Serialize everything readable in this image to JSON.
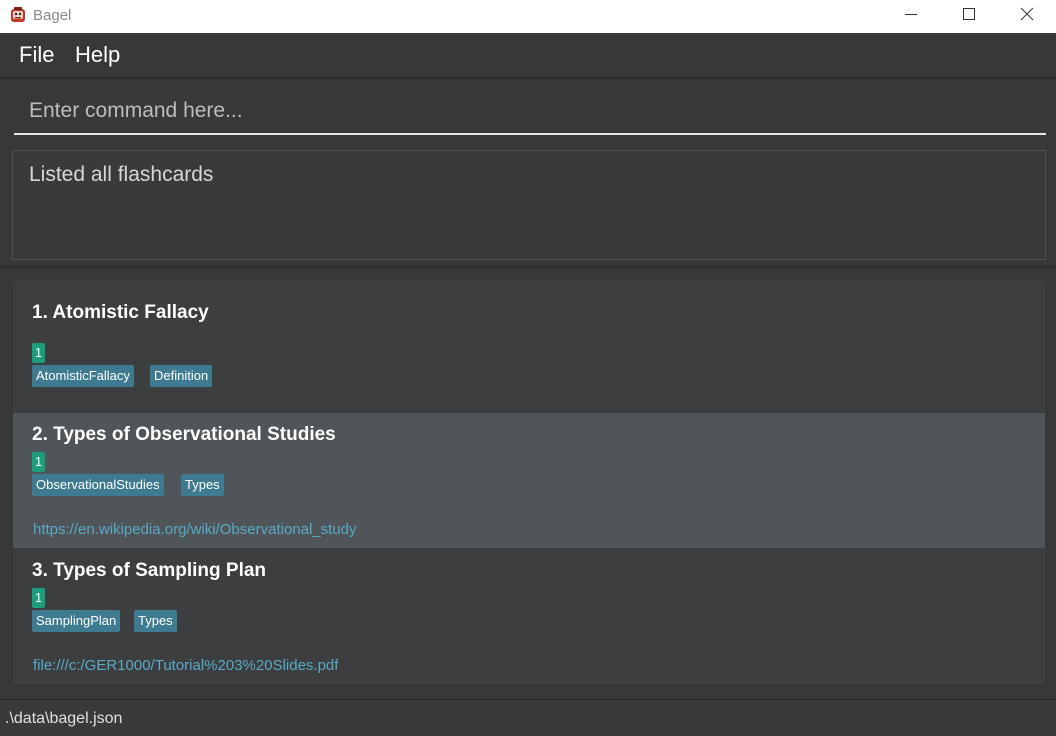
{
  "window": {
    "title": "Bagel",
    "icon": "bagel-app-icon"
  },
  "menu": {
    "file": "File",
    "help": "Help"
  },
  "command": {
    "placeholder": "Enter command here...",
    "value": ""
  },
  "result": {
    "message": "Listed all flashcards"
  },
  "flashcards": [
    {
      "title": "1.  Atomistic Fallacy",
      "count": "1",
      "tags": [
        "AtomisticFallacy",
        "Definition"
      ],
      "link": ""
    },
    {
      "title": "2.  Types of Observational Studies",
      "count": "1",
      "tags": [
        "ObservationalStudies",
        "Types"
      ],
      "link": "https://en.wikipedia.org/wiki/Observational_study",
      "selected": true
    },
    {
      "title": "3.  Types of Sampling Plan",
      "count": "1",
      "tags": [
        "SamplingPlan",
        "Types"
      ],
      "link": "file:///c:/GER1000/Tutorial%203%20Slides.pdf"
    }
  ],
  "status": {
    "path": ".\\data\\bagel.json"
  },
  "colors": {
    "background": "#383838",
    "selected_row": "#4f5558",
    "count_badge": "#1a9e7e",
    "tag": "#3e7b91",
    "link": "#5aa9c8"
  }
}
